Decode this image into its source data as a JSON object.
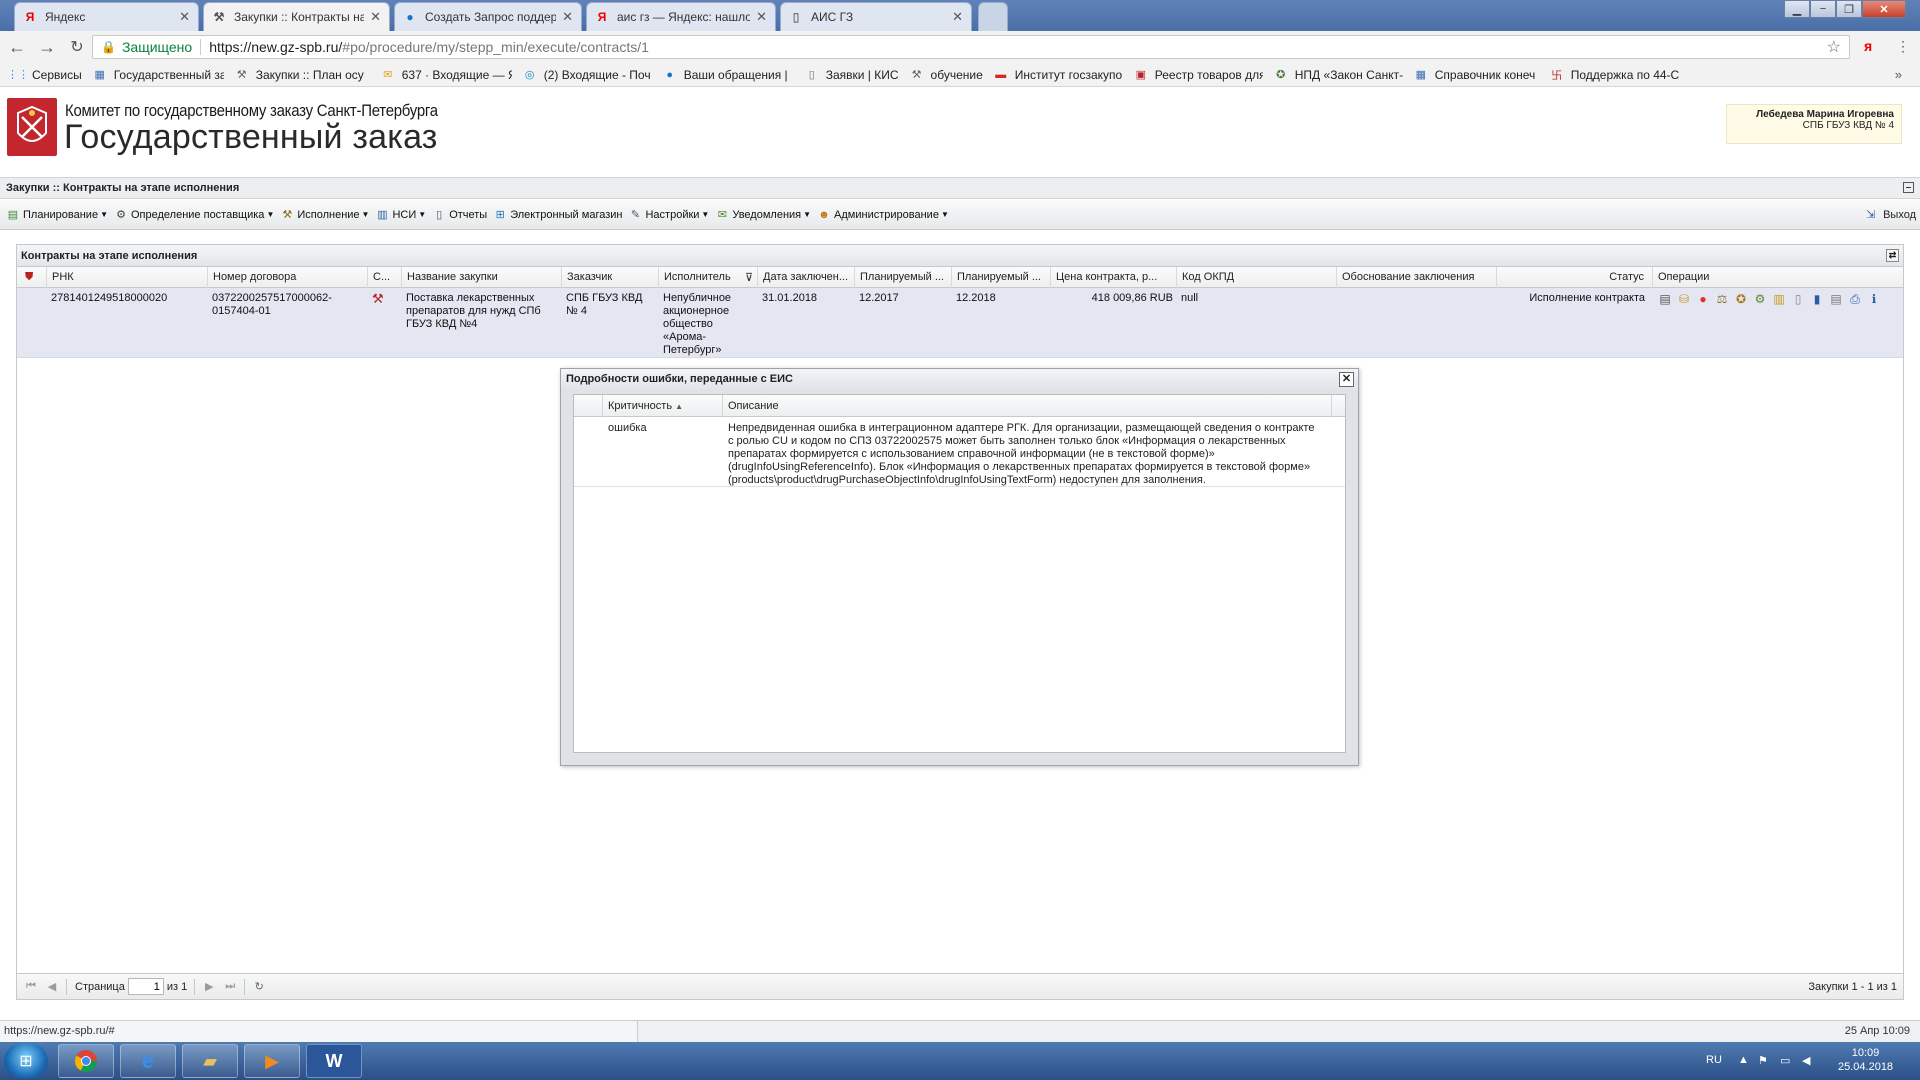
{
  "browser": {
    "tabs": [
      {
        "label": "Яндекс",
        "icon": "yandex-icon"
      },
      {
        "label": "Закупки :: Контракты на",
        "icon": "hammer-icon"
      },
      {
        "label": "Создать Запрос поддер",
        "icon": "globe-icon"
      },
      {
        "label": "аис гз — Яндекс: нашло",
        "icon": "yandex-icon"
      },
      {
        "label": "АИС ГЗ",
        "icon": "page-icon"
      }
    ],
    "secure_label": "Защищено",
    "url_host": "https://new.gz-spb.ru/",
    "url_path": "#po/procedure/my/stepp_min/execute/contracts/1",
    "bookmarks": [
      {
        "label": "Сервисы",
        "icon": "apps-icon"
      },
      {
        "label": "Государственный за",
        "icon": "building-icon"
      },
      {
        "label": "Закупки :: План осу",
        "icon": "hammer-icon"
      },
      {
        "label": "637 · Входящие — Я",
        "icon": "mail-icon"
      },
      {
        "label": "(2) Входящие - Поч",
        "icon": "mailbox-icon"
      },
      {
        "label": "Ваши обращения |",
        "icon": "globe-icon"
      },
      {
        "label": "Заявки | КИС",
        "icon": "page-icon"
      },
      {
        "label": "обучение",
        "icon": "hammer-icon"
      },
      {
        "label": "Институт госзакупо",
        "icon": "flag-icon"
      },
      {
        "label": "Реестр товаров для",
        "icon": "registry-icon"
      },
      {
        "label": "НПД «Закон Санкт-",
        "icon": "emblem-icon"
      },
      {
        "label": "Справочник конеч",
        "icon": "building-icon"
      },
      {
        "label": "Поддержка по 44-С",
        "icon": "support-icon"
      }
    ],
    "bookmarks_more": "»"
  },
  "header": {
    "committee": "Комитет по государственному заказу Санкт-Петербурга",
    "title": "Государственный заказ",
    "user_name": "Лебедева Марина Игоревна",
    "user_org": "СПБ ГБУЗ КВД № 4"
  },
  "breadcrumb": "Закупки :: Контракты на этапе исполнения",
  "menu": [
    {
      "label": "Планирование",
      "icon": "plan-icon",
      "dropdown": true
    },
    {
      "label": "Определение поставщика",
      "icon": "gears-icon",
      "dropdown": true
    },
    {
      "label": "Исполнение",
      "icon": "execution-icon",
      "dropdown": true
    },
    {
      "label": "НСИ",
      "icon": "book-icon",
      "dropdown": true
    },
    {
      "label": "Отчеты",
      "icon": "report-icon",
      "dropdown": false
    },
    {
      "label": "Электронный магазин",
      "icon": "cart-icon",
      "dropdown": false
    },
    {
      "label": "Настройки",
      "icon": "wrench-icon",
      "dropdown": true
    },
    {
      "label": "Уведомления",
      "icon": "envelope-icon",
      "dropdown": true
    },
    {
      "label": "Администрирование",
      "icon": "user-icon",
      "dropdown": true
    }
  ],
  "logout_label": "Выход",
  "grid": {
    "title": "Контракты на этапе исполнения",
    "columns": [
      "РНК",
      "Номер договора",
      "С...",
      "Название закупки",
      "Заказчик",
      "Исполнитель",
      "Дата заключен...",
      "Планируемый ...",
      "Планируемый ...",
      "Цена контракта, р...",
      "Код ОКПД",
      "Обоснование заключения",
      "Статус",
      "Операции"
    ],
    "row": {
      "rnk": "2781401249518000020",
      "contract_no": "0372200257517000062-0157404-01",
      "name": "Поставка лекарственных препаратов для нужд СПб ГБУЗ КВД №4",
      "customer": "СПБ ГБУЗ КВД № 4",
      "supplier": "Непубличное акционерное общество «Арома-Петербург»",
      "date": "31.01.2018",
      "plan1": "12.2017",
      "plan2": "12.2018",
      "price": "418 009,86 RUB",
      "okpd": "null",
      "status": "Исполнение контракта"
    },
    "ops_icons": [
      "doc-icon",
      "coins-icon",
      "red-circle-icon",
      "certificate-icon",
      "emblem-icon",
      "gear-icon",
      "scroll-icon",
      "page-icon",
      "chart-icon",
      "document-icon",
      "print-icon",
      "info-icon"
    ]
  },
  "pager": {
    "page_label": "Страница",
    "page_value": "1",
    "of_label": "из 1",
    "info": "Закупки 1 - 1 из 1"
  },
  "modal": {
    "title": "Подробности ошибки, переданные с ЕИС",
    "col_severity": "Критичность",
    "col_description": "Описание",
    "severity": "ошибка",
    "description": "Непредвиденная ошибка в интеграционном адаптере РГК. Для организации, размещающей сведения о контракте с ролью CU и кодом по СПЗ 03722002575 может быть заполнен только блок «Информация о лекарственных препаратах формируется с использованием справочной информации (не в текстовой форме)» (drugInfoUsingReferenceInfo). Блок «Информация о лекарственных препаратах формируется в текстовой форме» (products\\product\\drugPurchaseObjectInfo\\drugInfoUsingTextForm) недоступен для заполнения."
  },
  "status": {
    "url": "https://new.gz-spb.ru/#",
    "datetime": "25 Апр 10:09"
  },
  "taskbar": {
    "lang": "RU",
    "time": "10:09",
    "date": "25.04.2018"
  },
  "colors": {
    "selected_row": "#e4e6f1",
    "brand_red": "#c3272d",
    "taskbar": "#2c4f86"
  }
}
